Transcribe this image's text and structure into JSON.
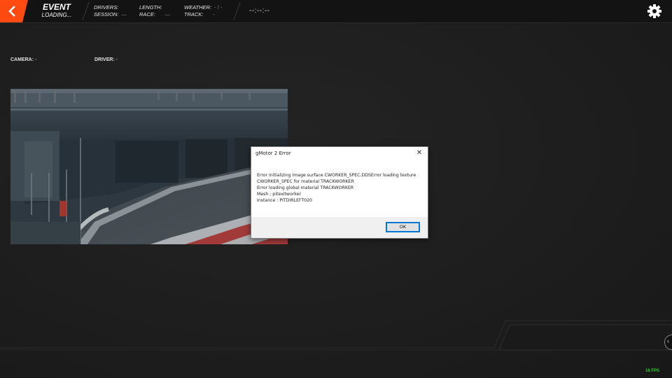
{
  "header": {
    "event_title": "EVENT",
    "event_status": "LOADING...",
    "drivers_label": "DRIVERS:",
    "drivers_value": "",
    "session_label": "SESSION:",
    "session_value": "—",
    "length_label": "LENGTH:",
    "length_value": "",
    "race_label": "RACE:",
    "race_value": "—",
    "weather_label": "WEATHER:",
    "weather_value": "- / -",
    "track_label": "TRACK:",
    "track_value": "-",
    "timer": "--:--:--"
  },
  "camera": {
    "label": "CAMERA:",
    "value": "-"
  },
  "driver": {
    "label": "DRIVER:",
    "value": "-"
  },
  "dialog": {
    "title": "gMotor 2 Error",
    "close_symbol": "✕",
    "lines": [
      "Error initializing image surface CWORKER_SPEC.DDSError loading texture",
      "CWORKER_SPEC for material TRACKWORKER",
      "Error loading global material TRACKWORKER",
      "Mesh : pitexitworker",
      "Instance : PITDIRLEFT020"
    ],
    "ok_label": "OK"
  },
  "footer": {
    "fps": "18 FPS"
  },
  "colors": {
    "accent": "#ff4a12",
    "fps": "#25d225",
    "dialog_focus": "#0078d7"
  },
  "icons": {
    "back": "chevron-left-icon",
    "settings": "gear-icon",
    "side": "chevron-left-circle-icon"
  }
}
